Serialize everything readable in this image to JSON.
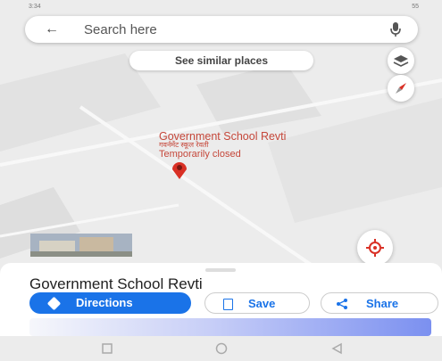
{
  "status_bar": {
    "time": "3:34",
    "battery": "55"
  },
  "search": {
    "placeholder": "Search here"
  },
  "chips": {
    "similar": "See similar places"
  },
  "poi": {
    "name": "Government School Revti",
    "name_local": "गवर्नमेंट स्कूल रेवती",
    "status": "Temporarily closed"
  },
  "sheet": {
    "title": "Government School Revti",
    "directions": "Directions",
    "save": "Save",
    "share": "Share"
  },
  "colors": {
    "accent": "#1a73e8",
    "pin": "#d93025",
    "poi_text": "#c5473a"
  }
}
